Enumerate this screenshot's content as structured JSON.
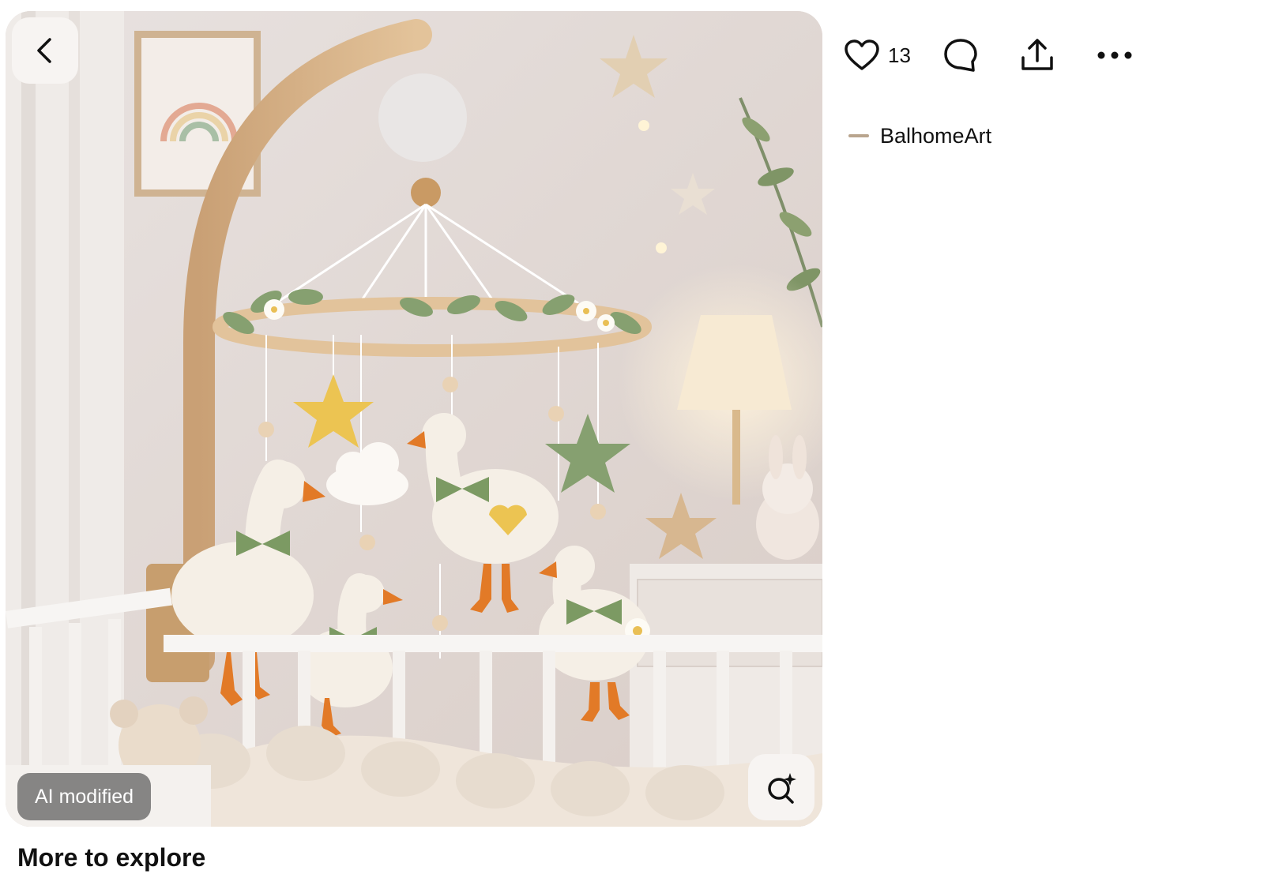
{
  "pin": {
    "badge_label": "AI modified",
    "back_icon": "chevron-left-icon",
    "lens_icon": "visual-search-icon"
  },
  "actions": {
    "like_icon": "heart-icon",
    "like_count": "13",
    "comment_icon": "comment-icon",
    "share_icon": "share-icon",
    "more_icon": "more-horizontal-icon"
  },
  "creator": {
    "name": "BalhomeArt"
  },
  "section": {
    "more_title": "More to explore"
  },
  "colors": {
    "text": "#111111",
    "badge_bg": "#6e6c6c",
    "button_bg": "#f7f4f2"
  }
}
